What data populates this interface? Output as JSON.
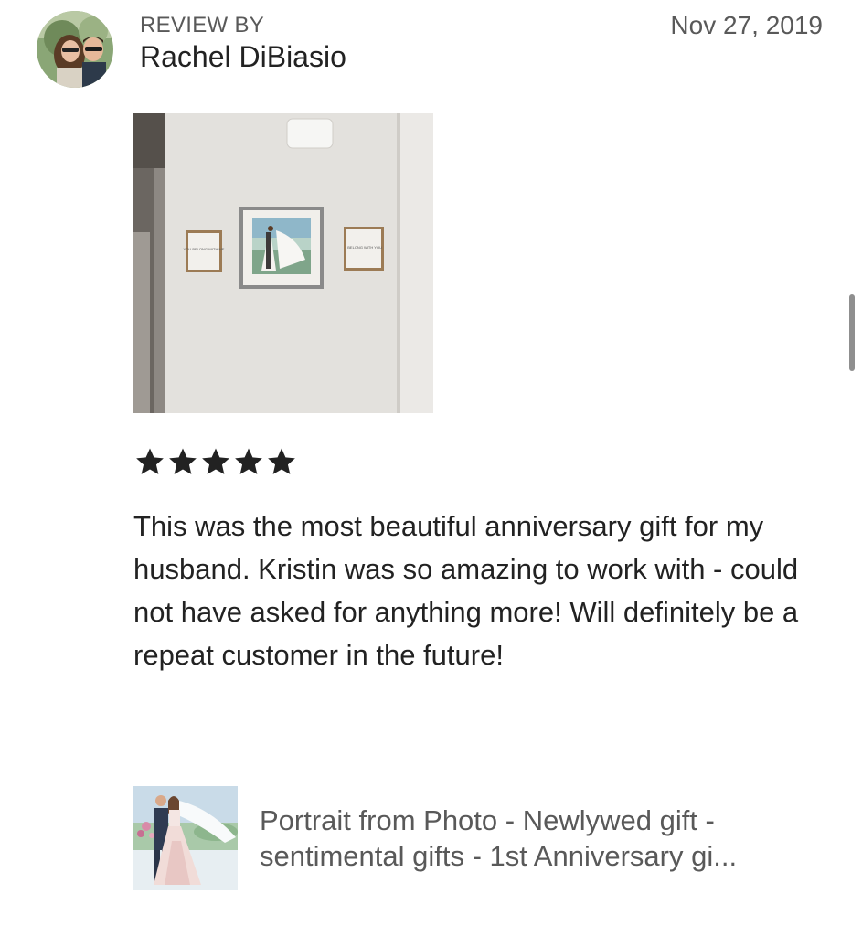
{
  "review": {
    "label": "REVIEW BY",
    "reviewer_name": "Rachel DiBiasio",
    "date": "Nov 27, 2019",
    "rating": 5,
    "rating_max": 5,
    "text": "This was the most beautiful anniversary gift for my husband. Kristin was so amazing to work with - could not have asked for anything more! Will definitely be a repeat customer in the future!",
    "photo_sign_left": "YOU BELONG WITH ME",
    "photo_sign_right": "I BELONG WITH YOU"
  },
  "product": {
    "title": "Portrait from Photo - Newlywed gift - sentimental gifts - 1st Anniversary gi..."
  },
  "colors": {
    "primary_text": "#222222",
    "secondary_text": "#595959",
    "star": "#222222",
    "scrollbar": "#8f8f8f"
  },
  "icons": {
    "rating": "star-icon"
  }
}
